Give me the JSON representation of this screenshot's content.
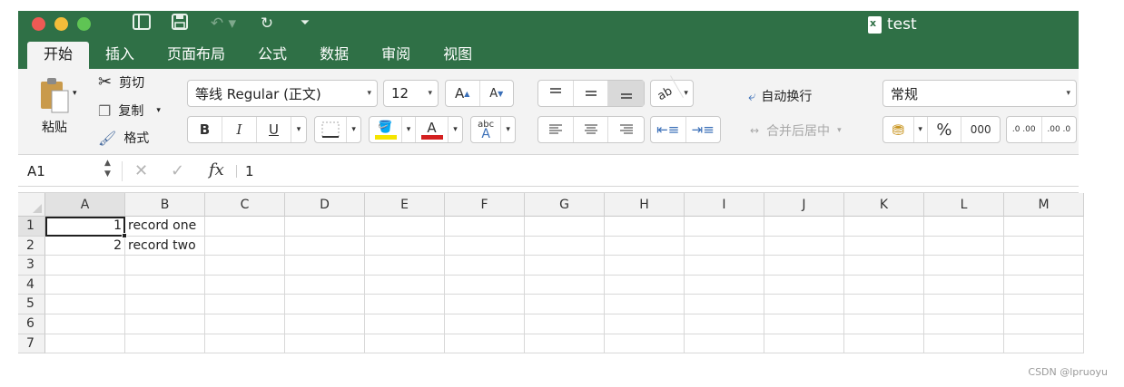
{
  "window": {
    "title": "test"
  },
  "tabs": [
    "开始",
    "插入",
    "页面布局",
    "公式",
    "数据",
    "审阅",
    "视图"
  ],
  "ribbon": {
    "paste_label": "粘贴",
    "cut_label": "剪切",
    "copy_label": "复制",
    "format_label": "格式",
    "font_name": "等线 Regular (正文)",
    "font_size": "12",
    "bold": "B",
    "italic": "I",
    "underline": "U",
    "wrap_text_label": "自动换行",
    "merge_center_label": "合并后居中",
    "number_format": "常规",
    "percent": "%",
    "thousands": "000",
    "dec_increase": ".0 .00",
    "dec_decrease": ".00 .0",
    "font_color_glyph": "A",
    "abc_glyph": "abc",
    "colors": {
      "fill_highlight": "#f5e400",
      "font_color": "#d42020",
      "ribbon_green": "#2f7046"
    }
  },
  "formula_bar": {
    "name_box": "A1",
    "fx": "fx",
    "value": "1"
  },
  "sheet": {
    "columns": [
      "A",
      "B",
      "C",
      "D",
      "E",
      "F",
      "G",
      "H",
      "I",
      "J",
      "K",
      "L",
      "M"
    ],
    "rows": [
      "1",
      "2",
      "3",
      "4",
      "5",
      "6",
      "7"
    ],
    "cells": {
      "A1": "1",
      "B1": "record one",
      "A2": "2",
      "B2": "record two"
    },
    "active_cell": "A1"
  },
  "watermark": "CSDN @lpruoyu"
}
